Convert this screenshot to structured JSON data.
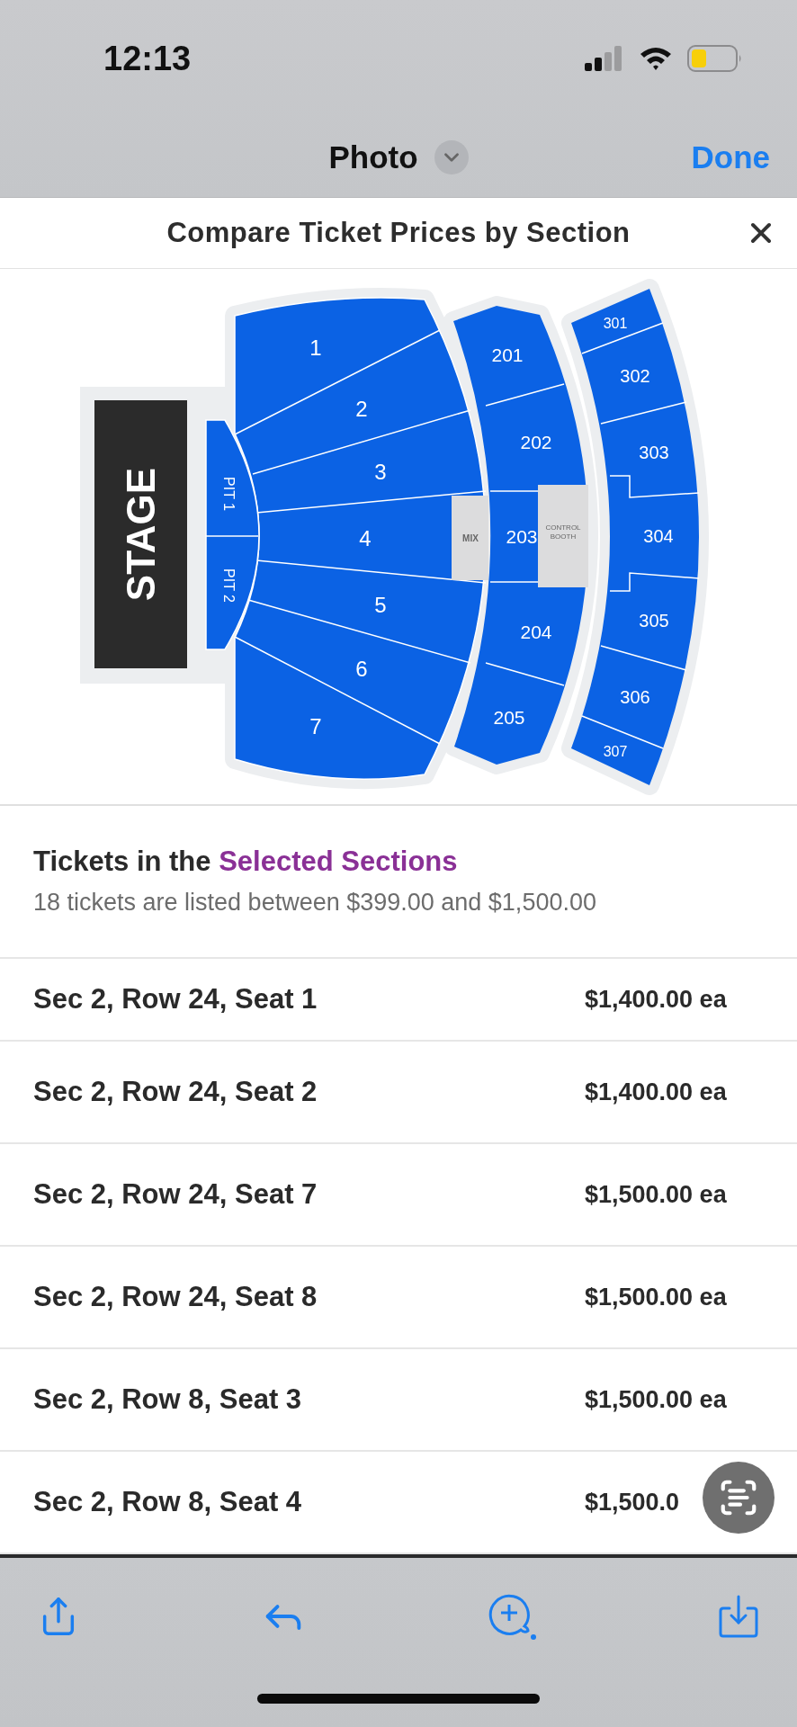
{
  "status_bar": {
    "time": "12:13"
  },
  "nav_bar": {
    "title": "Photo",
    "action": "Done"
  },
  "sheet": {
    "title": "Compare Ticket Prices by Section"
  },
  "seat_map": {
    "stage": "STAGE",
    "pits": [
      "PIT 1",
      "PIT 2"
    ],
    "mix": "MIX",
    "booth_lines": [
      "CONTROL",
      "BOOTH"
    ],
    "tiers": [
      {
        "sections": [
          "1",
          "2",
          "3",
          "4",
          "5",
          "6",
          "7"
        ]
      },
      {
        "sections": [
          "201",
          "202",
          "203",
          "204",
          "205"
        ]
      },
      {
        "sections": [
          "301",
          "302",
          "303",
          "304",
          "305",
          "306",
          "307"
        ]
      }
    ]
  },
  "summary": {
    "title_prefix": "Tickets in the",
    "title_highlight": "Selected Sections",
    "subtitle": "18 tickets are listed between $399.00 and $1,500.00"
  },
  "tickets": [
    {
      "seat": "Sec 2, Row 24, Seat 1",
      "price": "$1,400.00 ea"
    },
    {
      "seat": "Sec 2, Row 24, Seat 2",
      "price": "$1,400.00 ea"
    },
    {
      "seat": "Sec 2, Row 24, Seat 7",
      "price": "$1,500.00 ea"
    },
    {
      "seat": "Sec 2, Row 24, Seat 8",
      "price": "$1,500.00 ea"
    },
    {
      "seat": "Sec 2, Row 8, Seat 3",
      "price": "$1,500.00 ea"
    },
    {
      "seat": "Sec 2, Row 8, Seat 4",
      "price": "$1,500.0"
    }
  ]
}
